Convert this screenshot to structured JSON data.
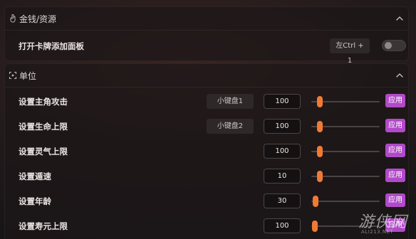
{
  "sections": {
    "money": {
      "title": "金钱/资源",
      "rows": [
        {
          "label": "打开卡牌添加面板",
          "hotkey": "左Ctrl + 1",
          "toggle_on": false
        }
      ]
    },
    "unit": {
      "title": "单位",
      "rows": [
        {
          "label": "设置主角攻击",
          "hotkey": "小键盘1",
          "value": "100",
          "slider_fraction": 0.12,
          "apply_label": "应用"
        },
        {
          "label": "设置生命上限",
          "hotkey": "小键盘2",
          "value": "100",
          "slider_fraction": 0.12,
          "apply_label": "应用"
        },
        {
          "label": "设置灵气上限",
          "hotkey": "",
          "value": "100",
          "slider_fraction": 0.12,
          "apply_label": "应用"
        },
        {
          "label": "设置遁速",
          "hotkey": "",
          "value": "10",
          "slider_fraction": 0.12,
          "apply_label": "应用"
        },
        {
          "label": "设置年龄",
          "hotkey": "",
          "value": "30",
          "slider_fraction": 0.06,
          "apply_label": "应用"
        },
        {
          "label": "设置寿元上限",
          "hotkey": "",
          "value": "100",
          "slider_fraction": 0.05,
          "apply_label": "应用"
        }
      ]
    }
  },
  "watermark": {
    "main": "游侠网",
    "sub": "ALI213.NET"
  },
  "colors": {
    "accent_orange": "#f07a35",
    "apply_purple": "#b14ac8"
  },
  "icons": {
    "money_section": "hand-pointer-icon",
    "unit_section": "unit-frame-icon",
    "collapse": "chevron-up-icon"
  }
}
